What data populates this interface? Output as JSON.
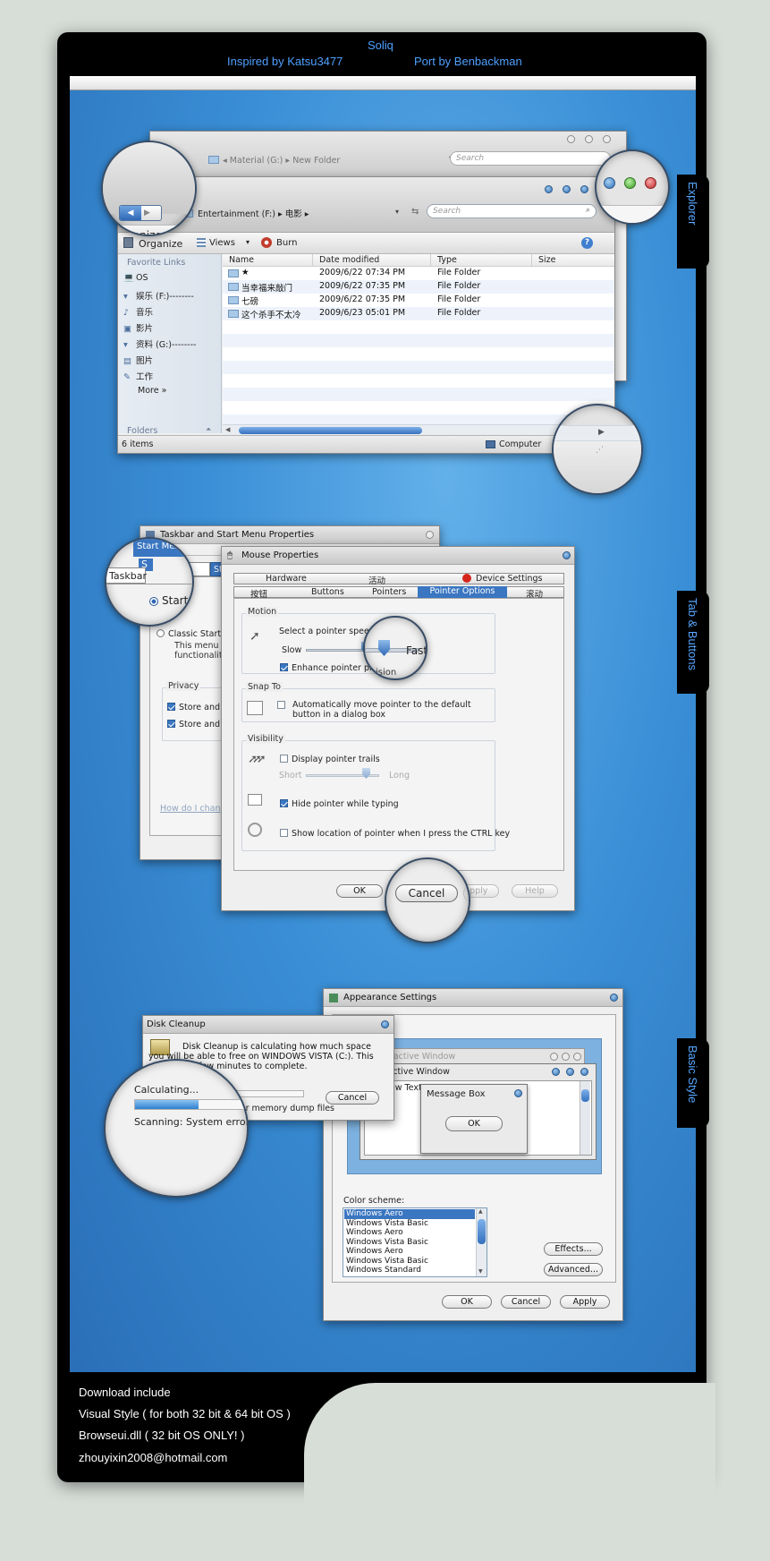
{
  "header": {
    "title": "Soliq",
    "inspired": "Inspired by Katsu3477",
    "port": "Port by Benbackman"
  },
  "side_tabs": [
    "Explorer",
    "Tab & Buttons",
    "Basic Style"
  ],
  "footer": {
    "lines": [
      "Download include",
      "Visual Style ( for both 32 bit & 64 bit OS )",
      "Browseui.dll ( 32 bit OS ONLY! )",
      "zhouyixin2008@hotmail.com"
    ]
  },
  "explorer_back": {
    "breadcrumb": [
      "Material (G:)",
      "New Folder"
    ],
    "search_placeholder": "Search"
  },
  "explorer": {
    "breadcrumb": [
      "Entertainment (F:)",
      "电影"
    ],
    "search_placeholder": "Search",
    "toolbar": {
      "organize": "Organize",
      "views": "Views",
      "burn": "Burn"
    },
    "nav_heading": "Favorite Links",
    "nav": [
      "OS",
      "娱乐 (F:)--------",
      "音乐",
      "影片",
      "资料 (G:)--------",
      "图片",
      "工作"
    ],
    "more": "More",
    "folders": "Folders",
    "columns": [
      "Name",
      "Date modified",
      "Type",
      "Size"
    ],
    "rows": [
      {
        "name": "★",
        "date": "2009/6/22 07:34 PM",
        "type": "File Folder"
      },
      {
        "name": "当幸福来敲门",
        "date": "2009/6/22 07:35 PM",
        "type": "File Folder"
      },
      {
        "name": "七磅",
        "date": "2009/6/22 07:35 PM",
        "type": "File Folder"
      },
      {
        "name": "这个杀手不太冷",
        "date": "2009/6/23 05:01 PM",
        "type": "File Folder"
      }
    ],
    "status": "6 items",
    "location": "Computer"
  },
  "taskbar_props": {
    "title": "Taskbar and Start Menu Properties",
    "tabs": [
      "Taskbar",
      "Start Menu"
    ],
    "start_label": "Start",
    "classic": "Classic Start m",
    "desc": [
      "This menu sty",
      "functionality o"
    ],
    "privacy": "Privacy",
    "store1": "Store and d",
    "store2": "Store and d",
    "link": "How do I change"
  },
  "mouse": {
    "title": "Mouse Properties",
    "tabs_row1": [
      "Hardware",
      "活动",
      "Device Settings"
    ],
    "tabs_row2": [
      "按钮",
      "Buttons",
      "Pointers",
      "Pointer Options",
      "滚动"
    ],
    "motion": "Motion",
    "select_speed": "Select a pointer speed:",
    "slow": "Slow",
    "fast": "Fast",
    "enhance": "Enhance pointer precision",
    "snap_to": "Snap To",
    "snap_desc": "Automatically move pointer to the default button in a dialog box",
    "visibility": "Visibility",
    "trails": "Display pointer trails",
    "short": "Short",
    "long": "Long",
    "hide": "Hide pointer while typing",
    "show_ctrl": "Show location of pointer when I press the CTRL key",
    "ok": "OK",
    "cancel": "Cancel",
    "apply": "Apply",
    "help": "Help",
    "speed_level": 0.68,
    "trail_level": 0.82
  },
  "disk": {
    "title": "Disk Cleanup",
    "message": "Disk Cleanup is calculating how much space you will be able to free on WINDOWS VISTA (C:). This may take a few minutes to complete.",
    "calculating": "Calculating...",
    "scanning_label": "Scanning:",
    "scanning_value": "System error memory dump files",
    "cancel": "Cancel",
    "progress": 0.45
  },
  "appearance": {
    "title": "Appearance Settings",
    "inactive": "Inactive Window",
    "active": "Active Window",
    "window_text": "Window Text",
    "message_box": "Message Box",
    "ok": "OK",
    "color_scheme": "Color scheme:",
    "schemes": [
      "Windows Aero",
      "Windows Vista Basic",
      "Windows Aero",
      "Windows Vista Basic",
      "Windows Aero",
      "Windows Vista Basic",
      "Windows Standard"
    ],
    "effects": "Effects...",
    "advanced": "Advanced...",
    "cancel": "Cancel",
    "apply": "Apply"
  }
}
